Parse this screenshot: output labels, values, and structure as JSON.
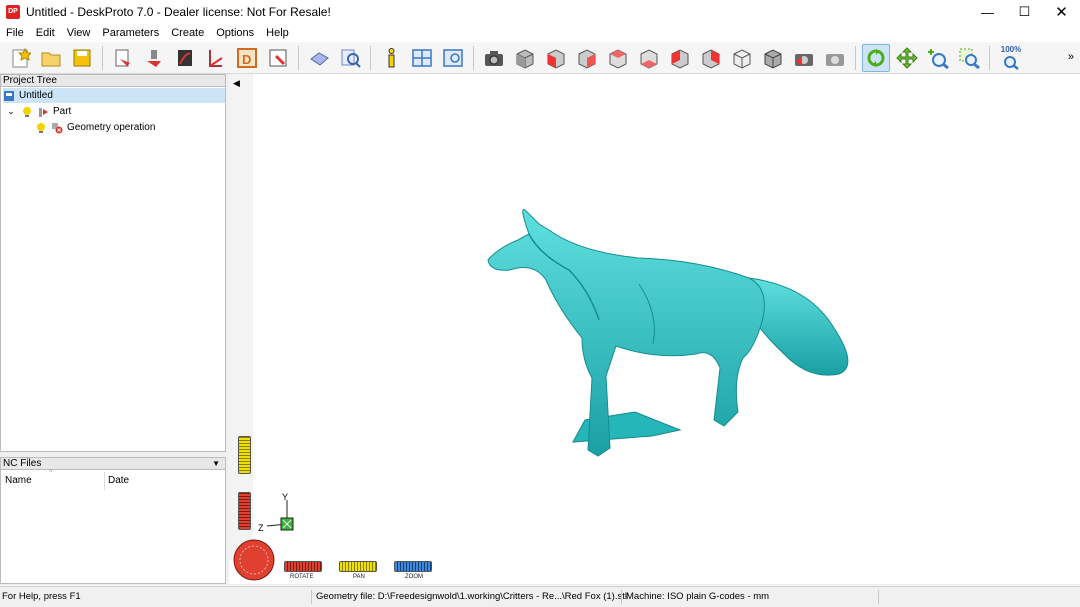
{
  "window": {
    "title": "Untitled - DeskProto 7.0 - Dealer license: Not For Resale!",
    "logo_text": "DP"
  },
  "menu": [
    "File",
    "Edit",
    "View",
    "Parameters",
    "Create",
    "Options",
    "Help"
  ],
  "toolbar": {
    "zoom_level": "100%",
    "more_label": "»"
  },
  "project_tree": {
    "header": "Project Tree",
    "items": [
      {
        "label": "Untitled",
        "icon": "project-icon",
        "selected": true
      },
      {
        "label": "Part",
        "icon": "part-icon"
      },
      {
        "label": "Geometry operation",
        "icon": "geometry-operation-icon"
      }
    ]
  },
  "nc_files": {
    "header": "NC Files",
    "columns": [
      "Name",
      "Date"
    ]
  },
  "viewport": {
    "dials": {
      "rotate": "ROTATE",
      "pan": "PAN",
      "zoom": "ZOOM"
    },
    "axes": {
      "y": "Y",
      "z": "Z"
    },
    "model_color": "#2ec4c4"
  },
  "status": {
    "help": "For Help, press F1",
    "geometry_file": "Geometry file: D:\\Freedesignwold\\1.working\\Critters - Re...\\Red Fox (1).stl",
    "machine": "Machine: ISO plain G-codes - mm"
  }
}
